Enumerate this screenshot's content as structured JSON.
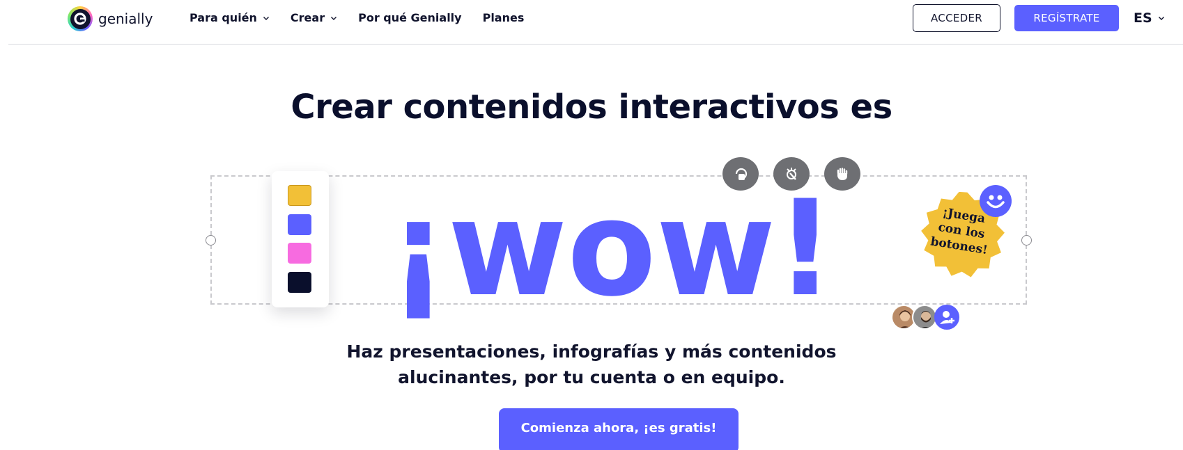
{
  "brand": {
    "name": "genially",
    "accent": "#5b60ff",
    "ink": "#11142d"
  },
  "nav": {
    "links": [
      {
        "label": "Para quién",
        "has_dropdown": true
      },
      {
        "label": "Crear",
        "has_dropdown": true
      },
      {
        "label": "Por qué Genially",
        "has_dropdown": false
      },
      {
        "label": "Planes",
        "has_dropdown": false
      }
    ],
    "login_label": "ACCEDER",
    "signup_label": "REGÍSTRATE",
    "language": "ES"
  },
  "hero": {
    "headline": "Crear contenidos interactivos es",
    "wow_text": "¡wow!",
    "palette_colors": [
      "#f2c037",
      "#5b60ff",
      "#f76be0",
      "#0a0f2c"
    ],
    "tool_icons": [
      "rotate-touch-icon",
      "click-icon",
      "grab-hand-icon"
    ],
    "badge_lines": [
      "¡Juega",
      "con los",
      "botones!"
    ],
    "badge_color": "#f2c037",
    "subline_1": "Haz presentaciones, infografías y más contenidos",
    "subline_2": "alucinantes, por tu cuenta o en equipo.",
    "cta_label": "Comienza ahora, ¡es gratis!"
  }
}
